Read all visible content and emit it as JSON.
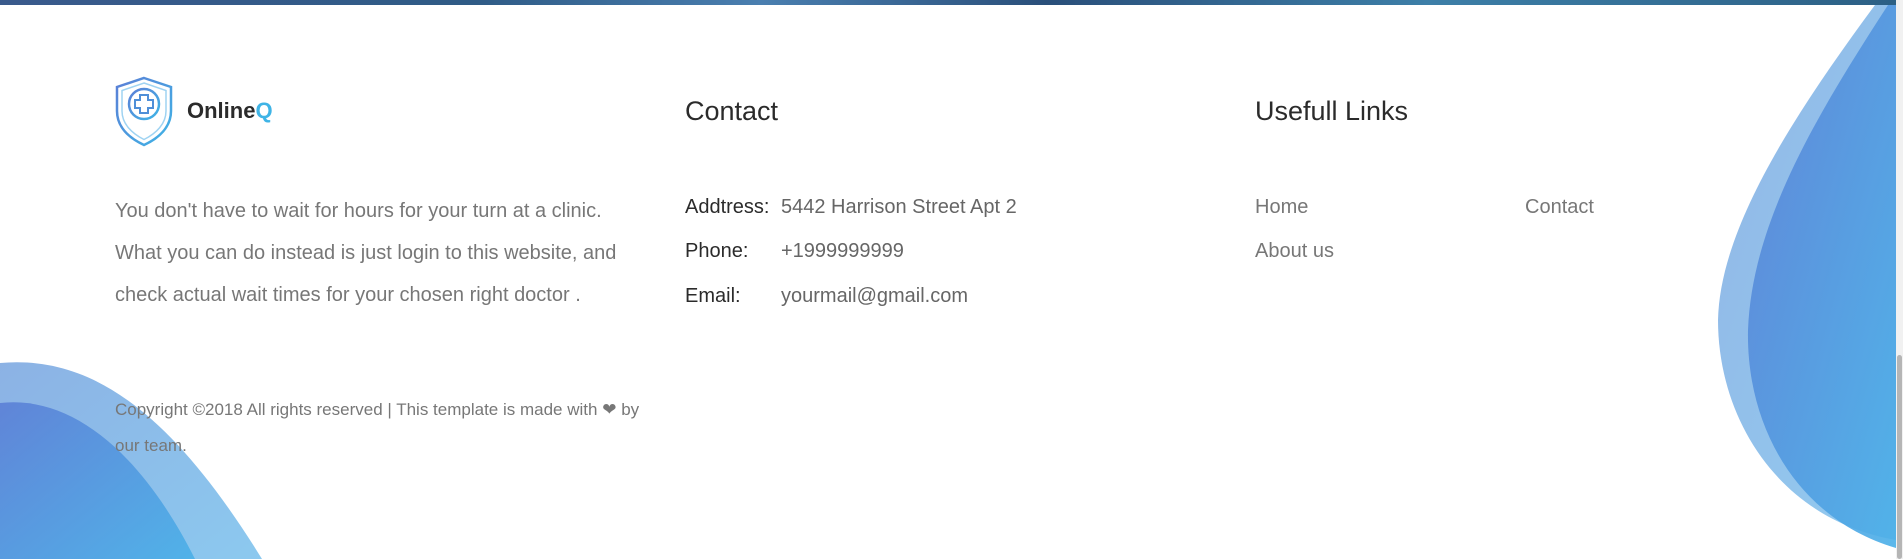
{
  "brand": {
    "name_main": "Online",
    "name_accent": "Q",
    "logo_icon": "shield-medical-cross-icon",
    "accent_color": "#3fb4e6"
  },
  "about": {
    "text": "You don't have to wait for hours for your turn at a clinic. What you can do instead is just login to this website, and check actual wait times for your chosen right doctor ."
  },
  "copyright": {
    "before_heart": "Copyright ©2018 All rights reserved | This template is made with",
    "heart_icon": "heart-icon",
    "after_heart": "by our team."
  },
  "contact": {
    "title": "Contact",
    "rows": [
      {
        "label": "Addtress:",
        "value": "5442 Harrison Street Apt 2"
      },
      {
        "label": "Phone:",
        "value": "+1999999999"
      },
      {
        "label": "Email:",
        "value": "yourmail@gmail.com"
      }
    ]
  },
  "links": {
    "title": "Usefull Links",
    "items": [
      {
        "label": "Home"
      },
      {
        "label": "Contact"
      },
      {
        "label": "About us"
      }
    ]
  },
  "colors": {
    "wave_light": "#7fc0ec",
    "wave_dark": "#4f8fd8",
    "heading": "#2b2b2b",
    "body_text": "#777777"
  }
}
